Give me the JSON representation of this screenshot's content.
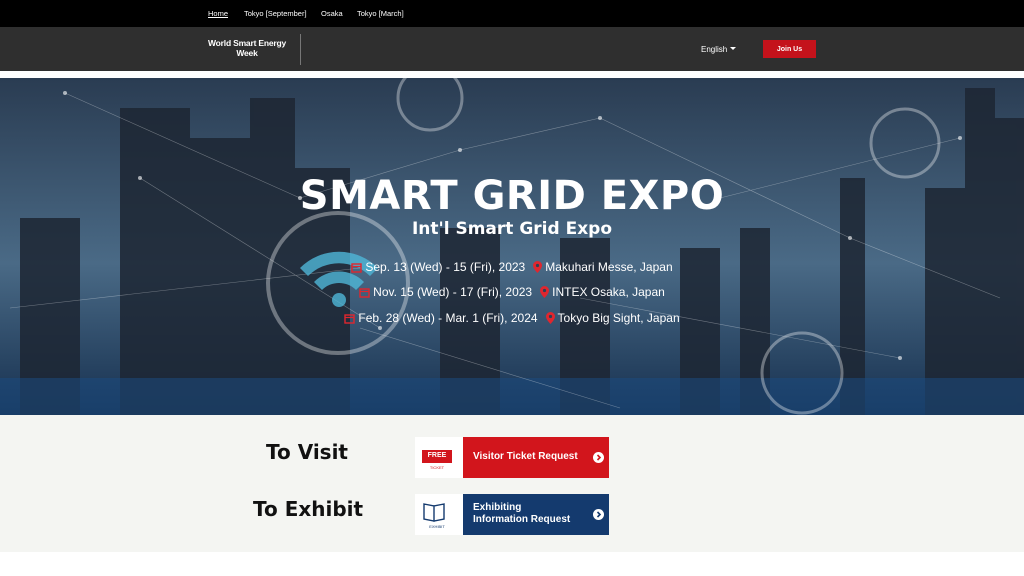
{
  "topnav": {
    "items": [
      "Home",
      "Tokyo [September]",
      "Osaka",
      "Tokyo [March]"
    ]
  },
  "header": {
    "logo_line1": "World Smart Energy",
    "logo_line2": "Week",
    "language": "English",
    "join_label": "Join Us"
  },
  "hero": {
    "title": "SMART GRID EXPO",
    "subtitle": "Int'l Smart Grid Expo",
    "events": [
      {
        "dates": "Sep. 13 (Wed) - 15 (Fri), 2023",
        "venue": "Makuhari Messe, Japan"
      },
      {
        "dates": "Nov. 15 (Wed) - 17 (Fri), 2023",
        "venue": "INTEX Osaka, Japan"
      },
      {
        "dates": "Feb. 28 (Wed) - Mar. 1 (Fri), 2024",
        "venue": "Tokyo Big Sight, Japan"
      }
    ]
  },
  "cta": {
    "visit_label": "To Visit",
    "exhibit_label": "To Exhibit",
    "visitor_button": {
      "badge": "FREE",
      "badge_sub": "TICKET",
      "text": "Visitor Ticket Request"
    },
    "exhibit_button": {
      "badge_sub": "EXHIBIT",
      "line1": "Exhibiting",
      "line2": "Information Request"
    }
  },
  "colors": {
    "accent_red": "#c4121b",
    "navy": "#143a6e",
    "icon_red": "#e0262e"
  }
}
